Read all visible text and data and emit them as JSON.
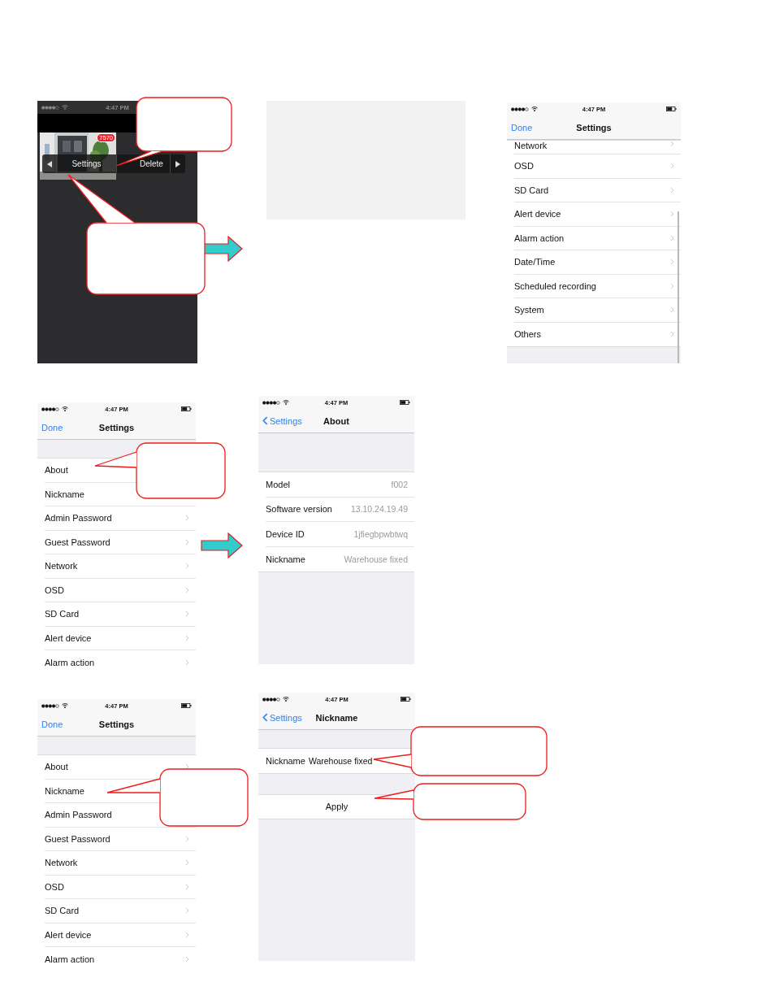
{
  "rows": [
    {
      "figures": [
        {
          "kind": "camera_screen",
          "status_bar": {
            "time": "4:47 PM"
          },
          "camera": {
            "kind": "picture",
            "badge": "7570"
          },
          "actions": [
            "Settings",
            "Delete"
          ]
        },
        {
          "kind": "arrow"
        },
        {
          "kind": "blank"
        },
        {
          "kind": "settings_screen",
          "scrolled": true,
          "status_bar": {
            "time": "4:47 PM",
            "battery": true
          },
          "nav": {
            "left": "Done",
            "back": false,
            "title": "Settings"
          },
          "sections": [
            [
              {
                "kind": "link",
                "label": "Network",
                "chevron": true
              },
              {
                "kind": "link",
                "label": "OSD",
                "chevron": true
              },
              {
                "kind": "link",
                "label": "SD Card",
                "chevron": true
              },
              {
                "kind": "link",
                "label": "Alert device",
                "chevron": true
              },
              {
                "kind": "link",
                "label": "Alarm action",
                "chevron": true
              },
              {
                "kind": "link",
                "label": "Date/Time",
                "chevron": true
              },
              {
                "kind": "link",
                "label": "Scheduled recording",
                "chevron": true
              },
              {
                "kind": "link",
                "label": "System",
                "chevron": true
              },
              {
                "kind": "link",
                "label": "Others",
                "chevron": true
              }
            ]
          ]
        }
      ]
    },
    {
      "figures": [
        {
          "kind": "settings_screen",
          "scrolled": false,
          "status_bar": {
            "time": "4:47 PM",
            "battery": true
          },
          "nav": {
            "left": "Done",
            "back": false,
            "title": "Settings"
          },
          "sections": [
            [
              {
                "kind": "link",
                "label": "About",
                "chevron": false
              },
              {
                "kind": "link",
                "label": "Nickname",
                "chevron": false
              },
              {
                "kind": "link",
                "label": "Admin Password",
                "chevron": true
              },
              {
                "kind": "link",
                "label": "Guest Password",
                "chevron": true
              },
              {
                "kind": "link",
                "label": "Network",
                "chevron": true
              },
              {
                "kind": "link",
                "label": "OSD",
                "chevron": true
              },
              {
                "kind": "link",
                "label": "SD Card",
                "chevron": true
              },
              {
                "kind": "link",
                "label": "Alert device",
                "chevron": true
              },
              {
                "kind": "link",
                "label": "Alarm action",
                "chevron": true
              }
            ]
          ]
        },
        {
          "kind": "arrow"
        },
        {
          "kind": "settings_screen",
          "scrolled": false,
          "status_bar": {
            "time": "4:47 PM",
            "battery": true
          },
          "nav": {
            "left": "Settings",
            "back": true,
            "title": "About"
          },
          "sections": [
            [
              {
                "kind": "detail",
                "label": "Model",
                "value": "f002"
              },
              {
                "kind": "detail",
                "label": "Software version",
                "value": "13.10.24.19.49"
              },
              {
                "kind": "detail",
                "label": "Device ID",
                "value": "1jfiegbpwbtwq"
              },
              {
                "kind": "detail",
                "label": "Nickname",
                "value": "Warehouse fixed"
              }
            ]
          ]
        }
      ]
    },
    {
      "figures": [
        {
          "kind": "settings_screen",
          "scrolled": false,
          "status_bar": {
            "time": "4:47 PM",
            "battery": true
          },
          "nav": {
            "left": "Done",
            "back": false,
            "title": "Settings"
          },
          "sections": [
            [
              {
                "kind": "link",
                "label": "About",
                "chevron": true
              },
              {
                "kind": "link",
                "label": "Nickname",
                "chevron": false
              },
              {
                "kind": "link",
                "label": "Admin Password",
                "chevron": false
              },
              {
                "kind": "link",
                "label": "Guest Password",
                "chevron": true
              },
              {
                "kind": "link",
                "label": "Network",
                "chevron": true
              },
              {
                "kind": "link",
                "label": "OSD",
                "chevron": true
              },
              {
                "kind": "link",
                "label": "SD Card",
                "chevron": true
              },
              {
                "kind": "link",
                "label": "Alert device",
                "chevron": true
              },
              {
                "kind": "link",
                "label": "Alarm action",
                "chevron": true
              }
            ]
          ]
        },
        {
          "kind": "settings_screen",
          "scrolled": false,
          "status_bar": {
            "time": "4:47 PM",
            "battery": true
          },
          "nav": {
            "left": "Settings",
            "back": true,
            "title": "Nickname"
          },
          "sections": [
            [
              {
                "kind": "field",
                "label": "Nickname",
                "value": "Warehouse fixed"
              }
            ],
            [
              {
                "kind": "button",
                "label": "Apply"
              }
            ]
          ]
        }
      ]
    }
  ]
}
